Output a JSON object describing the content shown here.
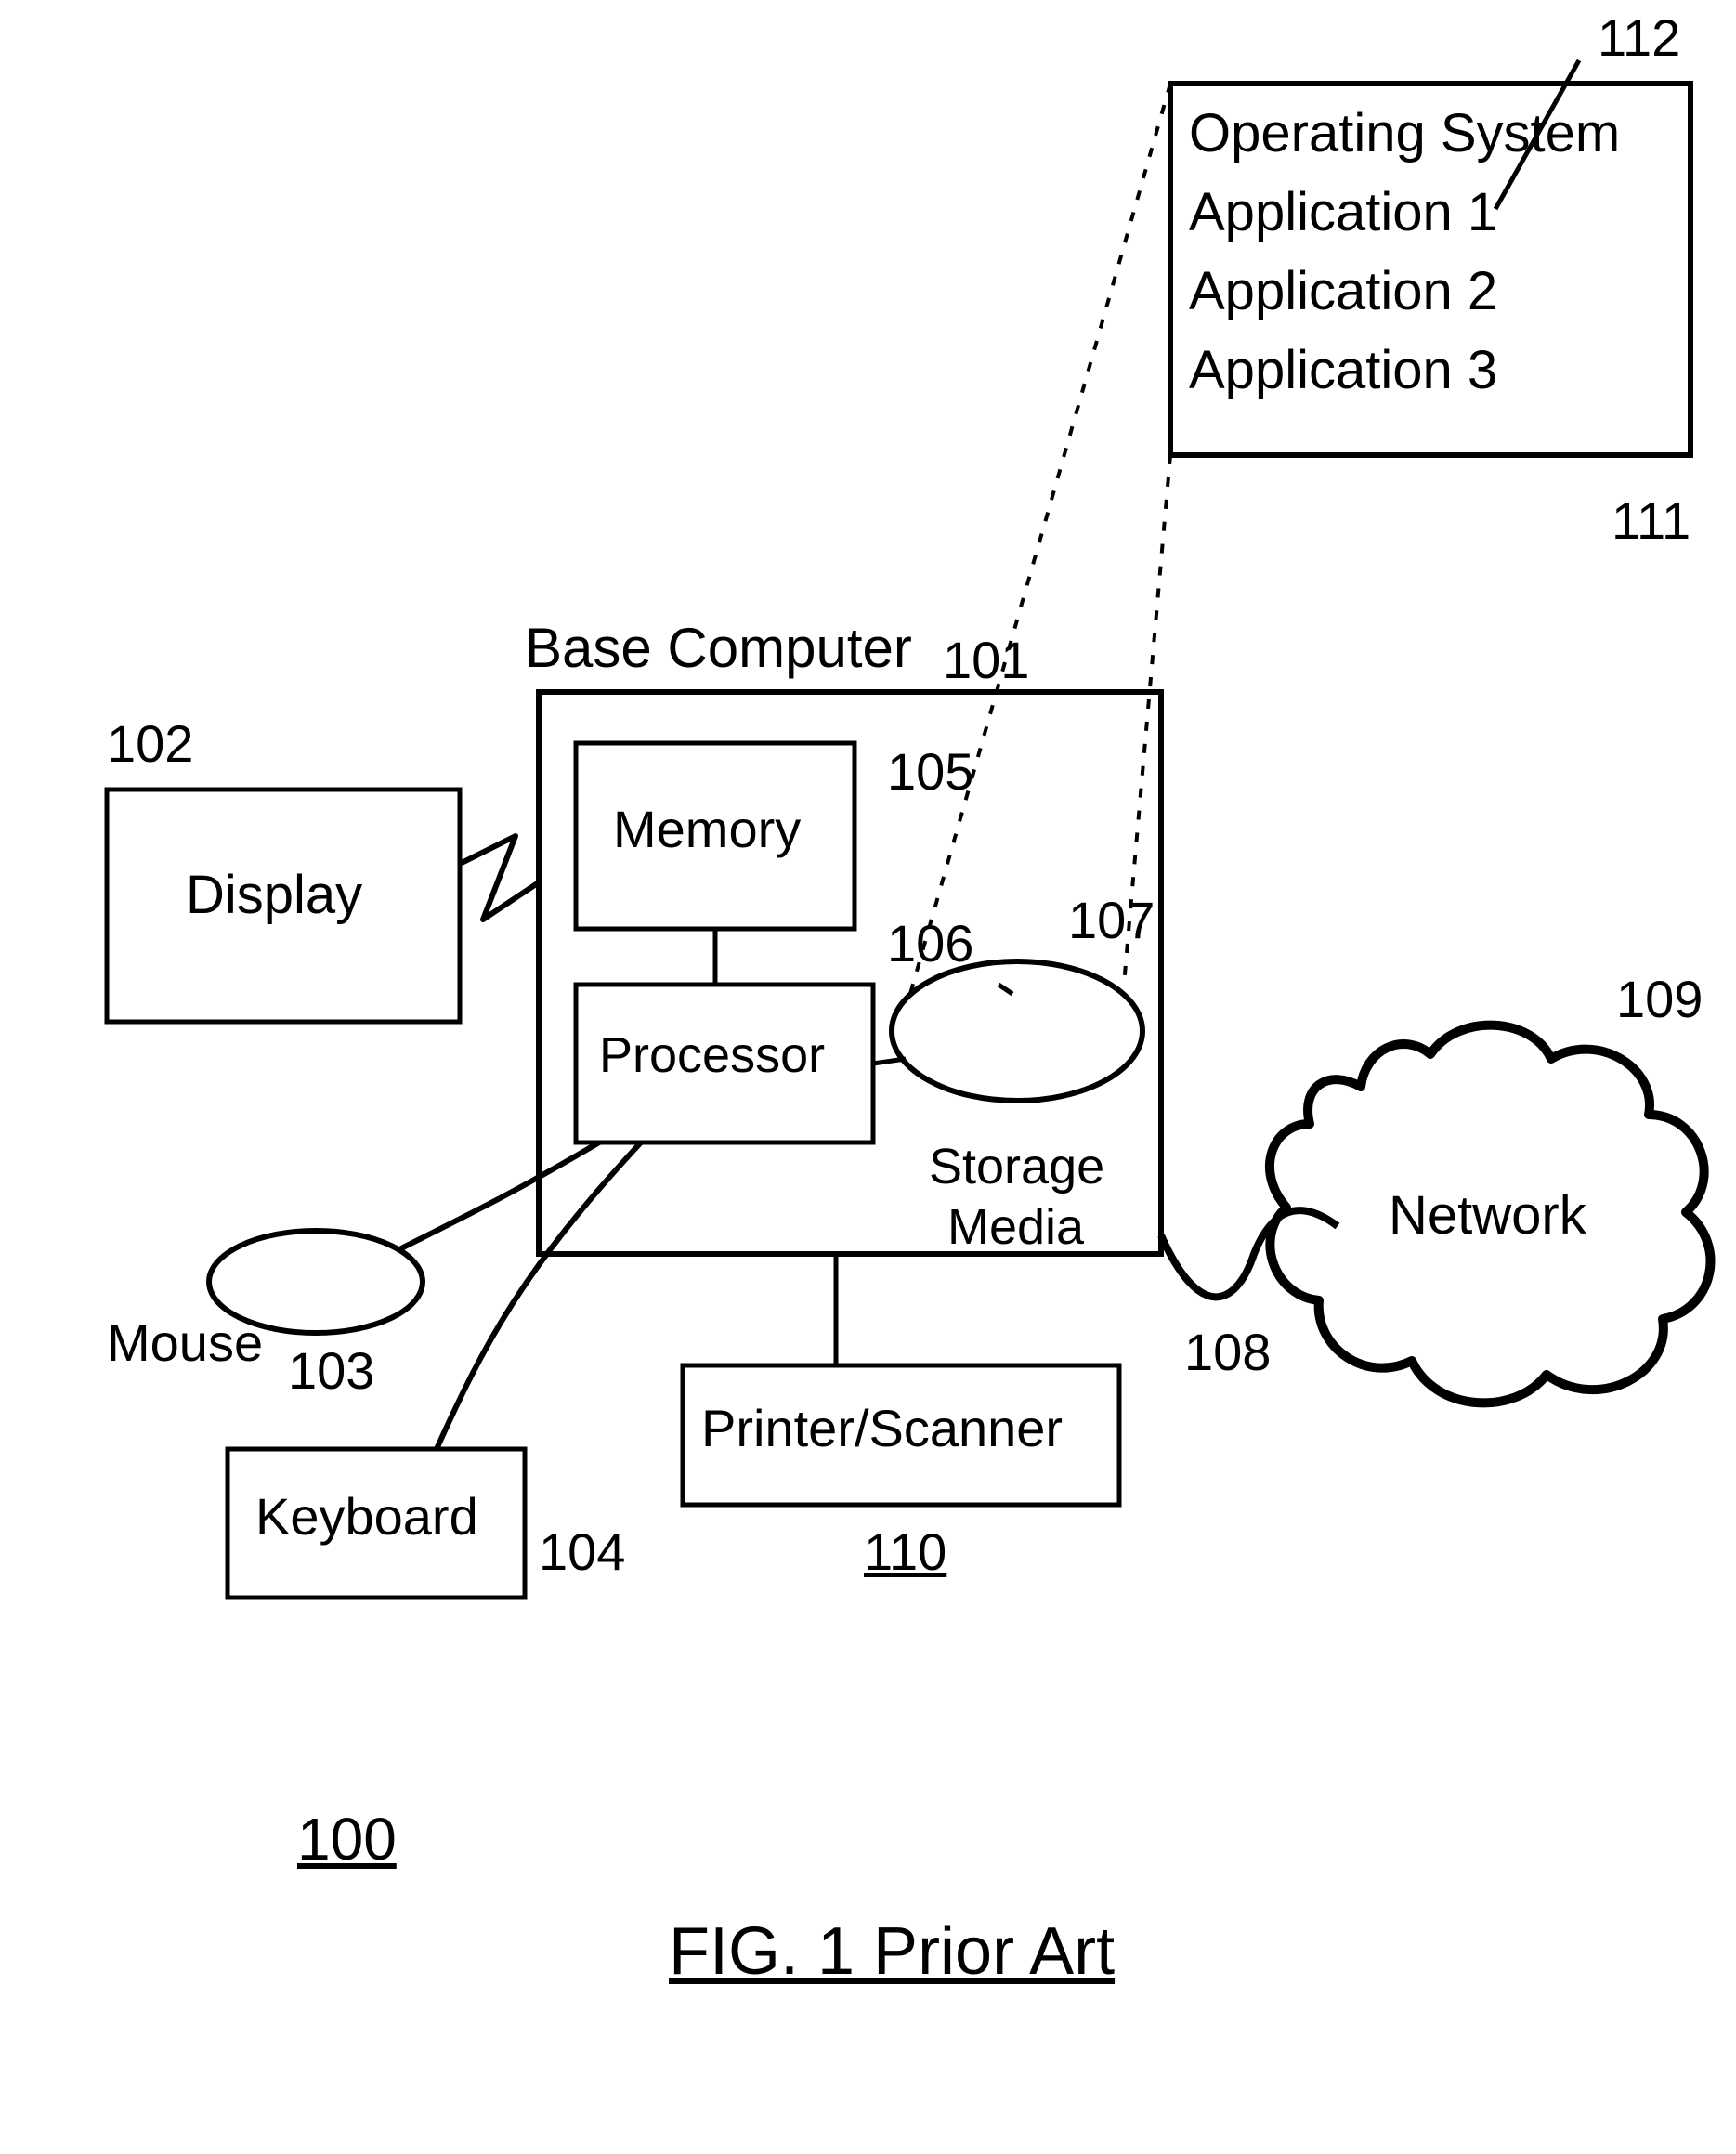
{
  "figure": {
    "title": "FIG. 1 Prior Art",
    "overall_ref": "100"
  },
  "refs": {
    "r101": "101",
    "r102": "102",
    "r103": "103",
    "r104": "104",
    "r105": "105",
    "r106": "106",
    "r107": "107",
    "r108": "108",
    "r109": "109",
    "r110": "110",
    "r111": "111",
    "r112": "112"
  },
  "blocks": {
    "base_computer": "Base Computer",
    "display": "Display",
    "mouse": "Mouse",
    "keyboard": "Keyboard",
    "memory": "Memory",
    "processor": "Processor",
    "storage_media_l1": "Storage",
    "storage_media_l2": "Media",
    "printer_scanner": "Printer/Scanner",
    "network": "Network"
  },
  "software_box": {
    "os": "Operating System",
    "app1": "Application 1",
    "app2": "Application 2",
    "app3": "Application 3"
  }
}
